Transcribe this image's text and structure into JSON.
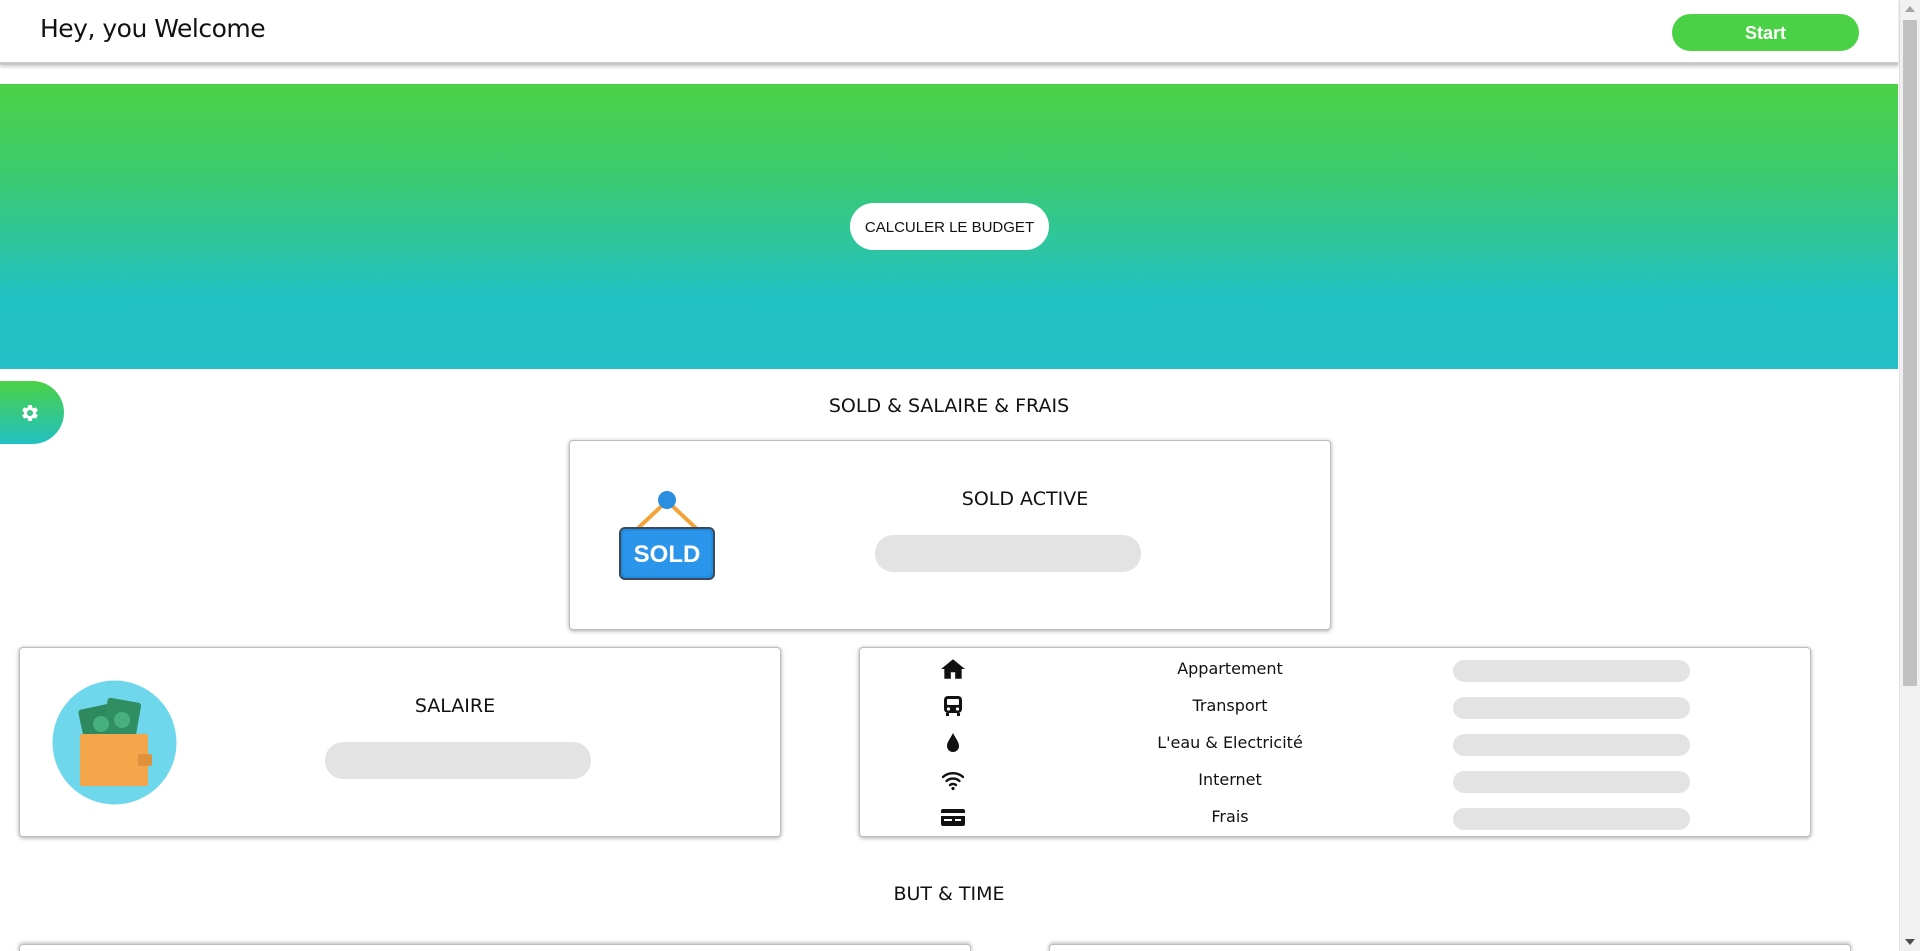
{
  "header": {
    "brand": "Hey, you Welcome",
    "start_label": "Start"
  },
  "hero": {
    "calc_label": "CALCULER LE BUDGET"
  },
  "settings": {
    "icon": "gear-icon"
  },
  "sections": {
    "sold_salaire_frais": "SOLD & SALAIRE & FRAIS",
    "but_time": "BUT & TIME"
  },
  "sold_card": {
    "title": "SOLD ACTIVE",
    "image_text": "SOLD",
    "value": ""
  },
  "salaire_card": {
    "title": "SALAIRE",
    "value": ""
  },
  "expenses": [
    {
      "icon": "home-icon",
      "label": "Appartement",
      "value": ""
    },
    {
      "icon": "bus-icon",
      "label": "Transport",
      "value": ""
    },
    {
      "icon": "water-drop-icon",
      "label": "L'eau & Electricité",
      "value": ""
    },
    {
      "icon": "wifi-icon",
      "label": "Internet",
      "value": ""
    },
    {
      "icon": "credit-card-icon",
      "label": "Frais",
      "value": ""
    }
  ],
  "colors": {
    "accent_green": "#4bd146",
    "accent_teal": "#22c1c3",
    "pill_gray": "#e3e3e4"
  }
}
